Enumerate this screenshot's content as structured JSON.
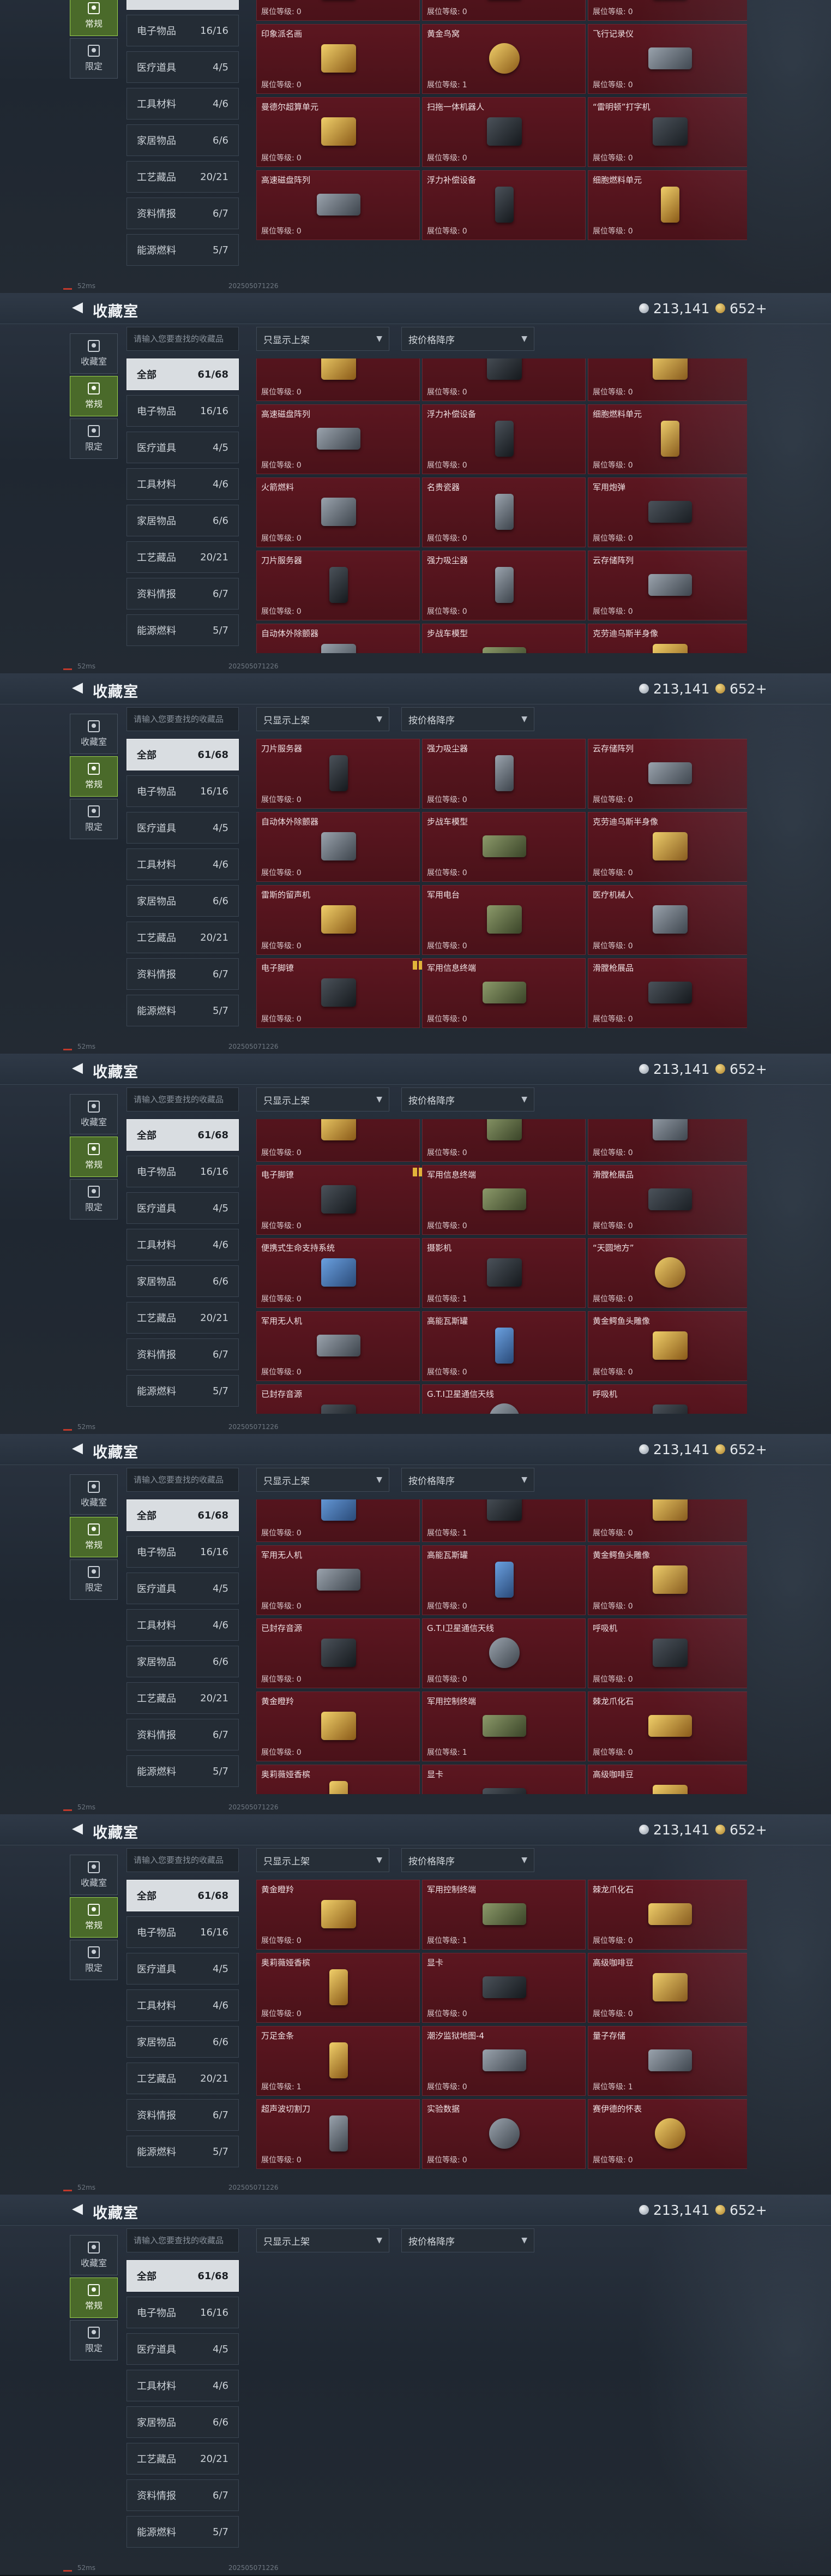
{
  "common": {
    "title": "收藏室",
    "silver": "213,141",
    "gold": "652+",
    "search_placeholder": "请输入您要查找的收藏品",
    "dropdown_filter": "只显示上架",
    "dropdown_sort": "按价格降序",
    "level_label": "展位等级:",
    "ping": "52ms",
    "build": "2025050712​26",
    "view_tabs": [
      {
        "label": "收藏室",
        "icon": "vault-icon"
      },
      {
        "label": "常规",
        "icon": "regular-icon"
      },
      {
        "label": "限定",
        "icon": "limited-icon"
      }
    ],
    "categories": [
      {
        "label": "全部",
        "count": "61/68"
      },
      {
        "label": "电子物品",
        "count": "16/16"
      },
      {
        "label": "医疗道具",
        "count": "4/5"
      },
      {
        "label": "工具材料",
        "count": "4/6"
      },
      {
        "label": "家居物品",
        "count": "6/6"
      },
      {
        "label": "工艺藏品",
        "count": "20/21"
      },
      {
        "label": "资料情报",
        "count": "6/7"
      },
      {
        "label": "能源燃料",
        "count": "5/7"
      }
    ]
  },
  "screens": [
    {
      "items": [
        {
          "name": "",
          "level": "0",
          "shape": "green"
        },
        {
          "name": "",
          "level": "0",
          "shape": ""
        },
        {
          "name": "",
          "level": "0",
          "shape": "dark"
        },
        {
          "name": "印象派名画",
          "level": "0",
          "shape": "gold"
        },
        {
          "name": "黄金鸟窝",
          "level": "1",
          "shape": "gold round"
        },
        {
          "name": "飞行记录仪",
          "level": "0",
          "shape": "wide"
        },
        {
          "name": "曼德尔超算单元",
          "level": "0",
          "shape": "gold"
        },
        {
          "name": "扫拖一体机器人",
          "level": "0",
          "shape": "dark"
        },
        {
          "name": "“雷明顿”打字机",
          "level": "0",
          "shape": "dark"
        },
        {
          "name": "高速磁盘阵列",
          "level": "0",
          "shape": "wide"
        },
        {
          "name": "浮力补偿设备",
          "level": "0",
          "shape": "dark tall"
        },
        {
          "name": "细胞燃料单元",
          "level": "0",
          "shape": "gold tall"
        }
      ]
    },
    {
      "items": [
        {
          "name": "",
          "level": "0",
          "shape": "gold"
        },
        {
          "name": "",
          "level": "0",
          "shape": "dark"
        },
        {
          "name": "",
          "level": "0",
          "shape": "gold"
        },
        {
          "name": "高速磁盘阵列",
          "level": "0",
          "shape": "wide"
        },
        {
          "name": "浮力补偿设备",
          "level": "0",
          "shape": "dark tall"
        },
        {
          "name": "细胞燃料单元",
          "level": "0",
          "shape": "gold tall"
        },
        {
          "name": "火箭燃料",
          "level": "0",
          "shape": ""
        },
        {
          "name": "名贵瓷器",
          "level": "0",
          "shape": "tall"
        },
        {
          "name": "军用炮弹",
          "level": "0",
          "shape": "dark wide"
        },
        {
          "name": "刀片服务器",
          "level": "0",
          "shape": "dark tall"
        },
        {
          "name": "强力吸尘器",
          "level": "0",
          "shape": "tall"
        },
        {
          "name": "云存储阵列",
          "level": "0",
          "shape": "wide"
        },
        {
          "name": "自动体外除颤器",
          "level": "0",
          "shape": ""
        },
        {
          "name": "步战车模型",
          "level": "0",
          "shape": "green wide"
        },
        {
          "name": "克劳迪乌斯半身像",
          "level": "0",
          "shape": "gold"
        }
      ]
    },
    {
      "items": [
        {
          "name": "刀片服务器",
          "level": "0",
          "shape": "dark tall"
        },
        {
          "name": "强力吸尘器",
          "level": "0",
          "shape": "tall"
        },
        {
          "name": "云存储阵列",
          "level": "0",
          "shape": "wide"
        },
        {
          "name": "自动体外除颤器",
          "level": "0",
          "shape": ""
        },
        {
          "name": "步战车模型",
          "level": "0",
          "shape": "green wide"
        },
        {
          "name": "克劳迪乌斯半身像",
          "level": "0",
          "shape": "gold"
        },
        {
          "name": "雷斯的留声机",
          "level": "0",
          "shape": "gold"
        },
        {
          "name": "军用电台",
          "level": "0",
          "shape": "green"
        },
        {
          "name": "医疗机械人",
          "level": "0",
          "shape": ""
        },
        {
          "name": "电子脚镣",
          "level": "0",
          "shape": "dark",
          "badge": true
        },
        {
          "name": "军用信息终端",
          "level": "0",
          "shape": "green wide"
        },
        {
          "name": "滑膛枪展品",
          "level": "0",
          "shape": "dark wide"
        }
      ]
    },
    {
      "items": [
        {
          "name": "",
          "level": "0",
          "shape": "gold"
        },
        {
          "name": "",
          "level": "0",
          "shape": "green"
        },
        {
          "name": "",
          "level": "0",
          "shape": ""
        },
        {
          "name": "电子脚镣",
          "level": "0",
          "shape": "dark",
          "badge": true
        },
        {
          "name": "军用信息终端",
          "level": "0",
          "shape": "green wide"
        },
        {
          "name": "滑膛枪展品",
          "level": "0",
          "shape": "dark wide"
        },
        {
          "name": "便携式生命支持系统",
          "level": "0",
          "shape": "blue"
        },
        {
          "name": "摄影机",
          "level": "1",
          "shape": "dark"
        },
        {
          "name": "“天圆地方”",
          "level": "0",
          "shape": "gold round"
        },
        {
          "name": "军用无人机",
          "level": "0",
          "shape": "wide"
        },
        {
          "name": "高能瓦斯罐",
          "level": "0",
          "shape": "blue tall"
        },
        {
          "name": "黄金鳄鱼头雕像",
          "level": "0",
          "shape": "gold"
        },
        {
          "name": "已封存音源",
          "level": "0",
          "shape": "dark"
        },
        {
          "name": "G.T.I卫星通信天线",
          "level": "0",
          "shape": "round"
        },
        {
          "name": "呼吸机",
          "level": "0",
          "shape": "dark"
        }
      ]
    },
    {
      "items": [
        {
          "name": "",
          "level": "0",
          "shape": "blue"
        },
        {
          "name": "",
          "level": "1",
          "shape": "dark"
        },
        {
          "name": "",
          "level": "0",
          "shape": "gold"
        },
        {
          "name": "军用无人机",
          "level": "0",
          "shape": "wide"
        },
        {
          "name": "高能瓦斯罐",
          "level": "0",
          "shape": "blue tall"
        },
        {
          "name": "黄金鳄鱼头雕像",
          "level": "0",
          "shape": "gold"
        },
        {
          "name": "已封存音源",
          "level": "0",
          "shape": "dark"
        },
        {
          "name": "G.T.I卫星通信天线",
          "level": "0",
          "shape": "round"
        },
        {
          "name": "呼吸机",
          "level": "0",
          "shape": "dark"
        },
        {
          "name": "黄金瞪羚",
          "level": "0",
          "shape": "gold"
        },
        {
          "name": "军用控制终端",
          "level": "1",
          "shape": "green wide"
        },
        {
          "name": "棘龙爪化石",
          "level": "0",
          "shape": "gold wide"
        },
        {
          "name": "奥莉薇娅香槟",
          "level": "0",
          "shape": "gold tall"
        },
        {
          "name": "显卡",
          "level": "0",
          "shape": "dark wide"
        },
        {
          "name": "高级咖啡豆",
          "level": "0",
          "shape": "gold"
        }
      ]
    },
    {
      "items": [
        {
          "name": "黄金瞪羚",
          "level": "0",
          "shape": "gold"
        },
        {
          "name": "军用控制终端",
          "level": "1",
          "shape": "green wide"
        },
        {
          "name": "棘龙爪化石",
          "level": "0",
          "shape": "gold wide"
        },
        {
          "name": "奥莉薇娅香槟",
          "level": "0",
          "shape": "gold tall"
        },
        {
          "name": "显卡",
          "level": "0",
          "shape": "dark wide"
        },
        {
          "name": "高级咖啡豆",
          "level": "0",
          "shape": "gold"
        },
        {
          "name": "万足金条",
          "level": "1",
          "shape": "gold tall"
        },
        {
          "name": "潮汐监狱地图-4",
          "level": "0",
          "shape": "wide"
        },
        {
          "name": "量子存储",
          "level": "1",
          "shape": "wide"
        },
        {
          "name": "超声波切割刀",
          "level": "0",
          "shape": "tall"
        },
        {
          "name": "实验数据",
          "level": "0",
          "shape": "round"
        },
        {
          "name": "赛伊德的怀表",
          "level": "0",
          "shape": "gold round"
        }
      ]
    },
    {
      "items": []
    }
  ]
}
